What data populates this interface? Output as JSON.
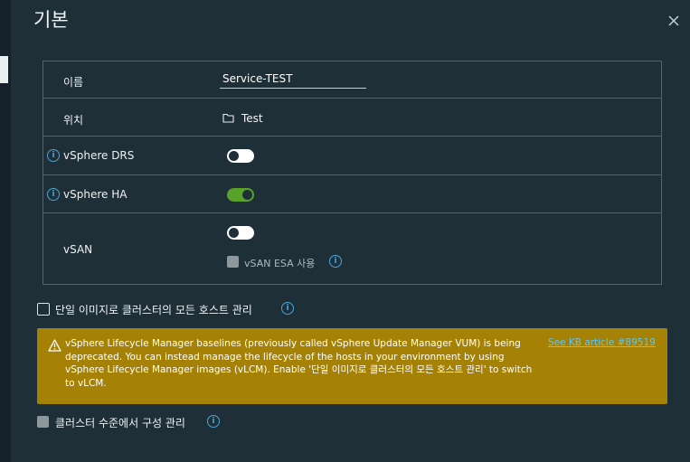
{
  "dialog": {
    "title": "기본"
  },
  "form": {
    "name_label": "이름",
    "name_value": "Service-TEST",
    "location_label": "위치",
    "location_value": "Test",
    "drs_label": "vSphere DRS",
    "drs_enabled": false,
    "ha_label": "vSphere HA",
    "ha_enabled": true,
    "vsan_label": "vSAN",
    "vsan_enabled": false,
    "vsan_esa_label": "vSAN ESA 사용",
    "vsan_esa_checked": false
  },
  "options": {
    "single_image_label": "단일 이미지로 클러스터의 모든 호스트 관리",
    "single_image_checked": false,
    "cluster_config_label": "클러스터 수준에서 구성 관리",
    "cluster_config_checked": false
  },
  "warning": {
    "text": "vSphere Lifecycle Manager baselines (previously called vSphere Update Manager VUM) is being deprecated. You can instead manage the lifecycle of the hosts in your environment by using vSphere Lifecycle Manager images (vLCM). Enable '단일 이미지로 클러스터의 모든 호스트 관리' to switch to vLCM.",
    "link": "See KB article #89519"
  },
  "colors": {
    "background": "#1e2f38",
    "toggle_on": "#57a229",
    "info": "#4aa6d9",
    "warning_bg": "#a58205",
    "link": "#5ec8f2"
  },
  "icons": [
    "close-icon",
    "folder-icon",
    "info-icon",
    "warning-icon"
  ]
}
